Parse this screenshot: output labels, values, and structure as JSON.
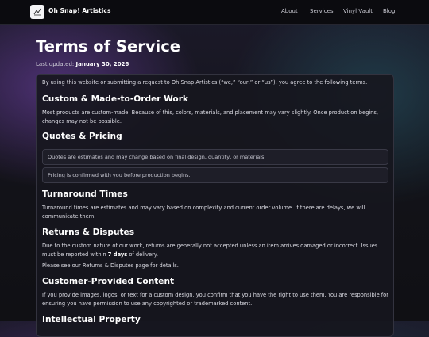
{
  "nav": {
    "brand": "Oh Snap! Artistics",
    "links": [
      "About",
      "Services",
      "Vinyl Vault",
      "Blog"
    ],
    "logo_icon": "camera-sketch-icon"
  },
  "page": {
    "title": "Terms of Service",
    "updated_label": "Last updated:",
    "updated_date": "January 30, 2026"
  },
  "content": {
    "intro": "By using this website or submitting a request to Oh Snap Artistics (“we,” “our,” or “us”), you agree to the following terms.",
    "sections": [
      {
        "heading": "Custom & Made-to-Order Work",
        "body": "Most products are custom-made. Because of this, colors, materials, and placement may vary slightly. Once production begins, changes may not be possible."
      },
      {
        "heading": "Quotes & Pricing",
        "notes": [
          "Quotes are estimates and may change based on final design, quantity, or materials.",
          "Pricing is confirmed with you before production begins."
        ]
      },
      {
        "heading": "Turnaround Times",
        "body": "Turnaround times are estimates and may vary based on complexity and current order volume. If there are delays, we will communicate them."
      },
      {
        "heading": "Returns & Disputes",
        "body_before": "Due to the custom nature of our work, returns are generally not accepted unless an item arrives damaged or incorrect. Issues must be reported within ",
        "body_bold": "7 days",
        "body_after": " of delivery.",
        "body2": "Please see our Returns & Disputes page for details."
      },
      {
        "heading": "Customer-Provided Content",
        "body": "If you provide images, logos, or text for a custom design, you confirm that you have the right to use them. You are responsible for ensuring you have permission to use any copyrighted or trademarked content."
      },
      {
        "heading": "Intellectual Property"
      }
    ]
  }
}
